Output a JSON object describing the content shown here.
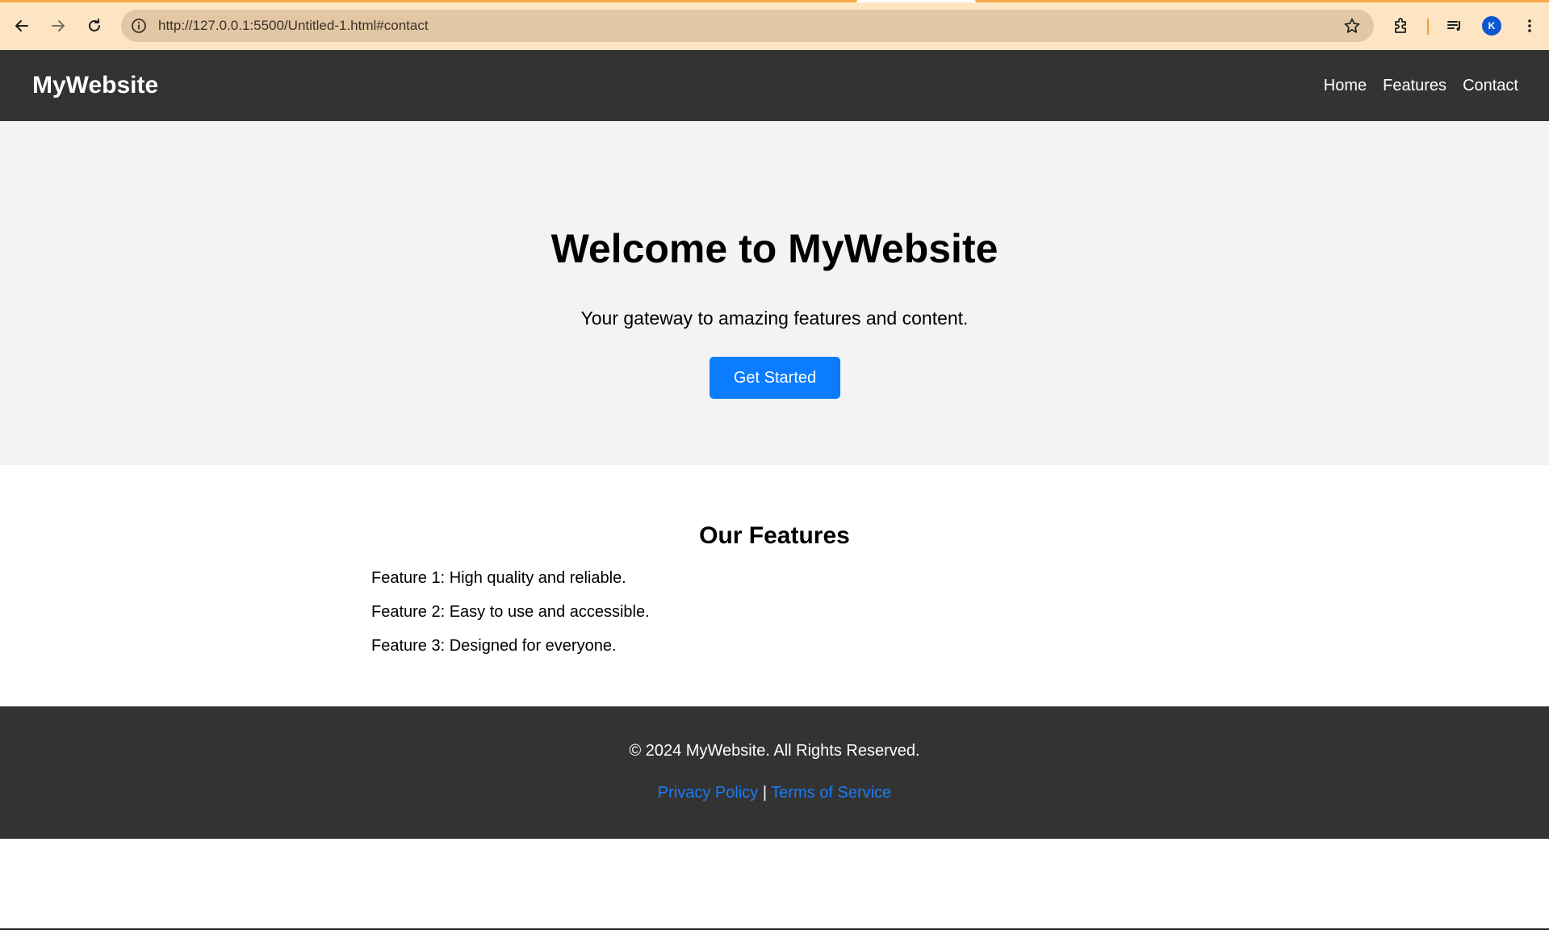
{
  "browser": {
    "url": "http://127.0.0.1:5500/Untitled-1.html#contact",
    "avatar_initial": "K",
    "accent_color": "#f7a94a"
  },
  "site": {
    "logo": "MyWebsite",
    "nav": [
      "Home",
      "Features",
      "Contact"
    ],
    "hero": {
      "title": "Welcome to MyWebsite",
      "subtitle": "Your gateway to amazing features and content.",
      "cta_label": "Get Started"
    },
    "features": {
      "heading": "Our Features",
      "items": [
        "Feature 1: High quality and reliable.",
        "Feature 2: Easy to use and accessible.",
        "Feature 3: Designed for everyone."
      ]
    },
    "footer": {
      "copyright": "© 2024 MyWebsite. All Rights Reserved.",
      "privacy": "Privacy Policy",
      "separator": "|",
      "terms": "Terms of Service"
    }
  },
  "colors": {
    "header_bg": "#333333",
    "hero_bg": "#f3f3f3",
    "cta_bg": "#0a7cfd",
    "link": "#1a7cf5"
  },
  "icons": [
    "back-arrow-icon",
    "forward-arrow-icon",
    "reload-icon",
    "site-info-icon",
    "bookmark-star-icon",
    "extensions-icon",
    "media-controls-icon",
    "more-menu-icon"
  ]
}
